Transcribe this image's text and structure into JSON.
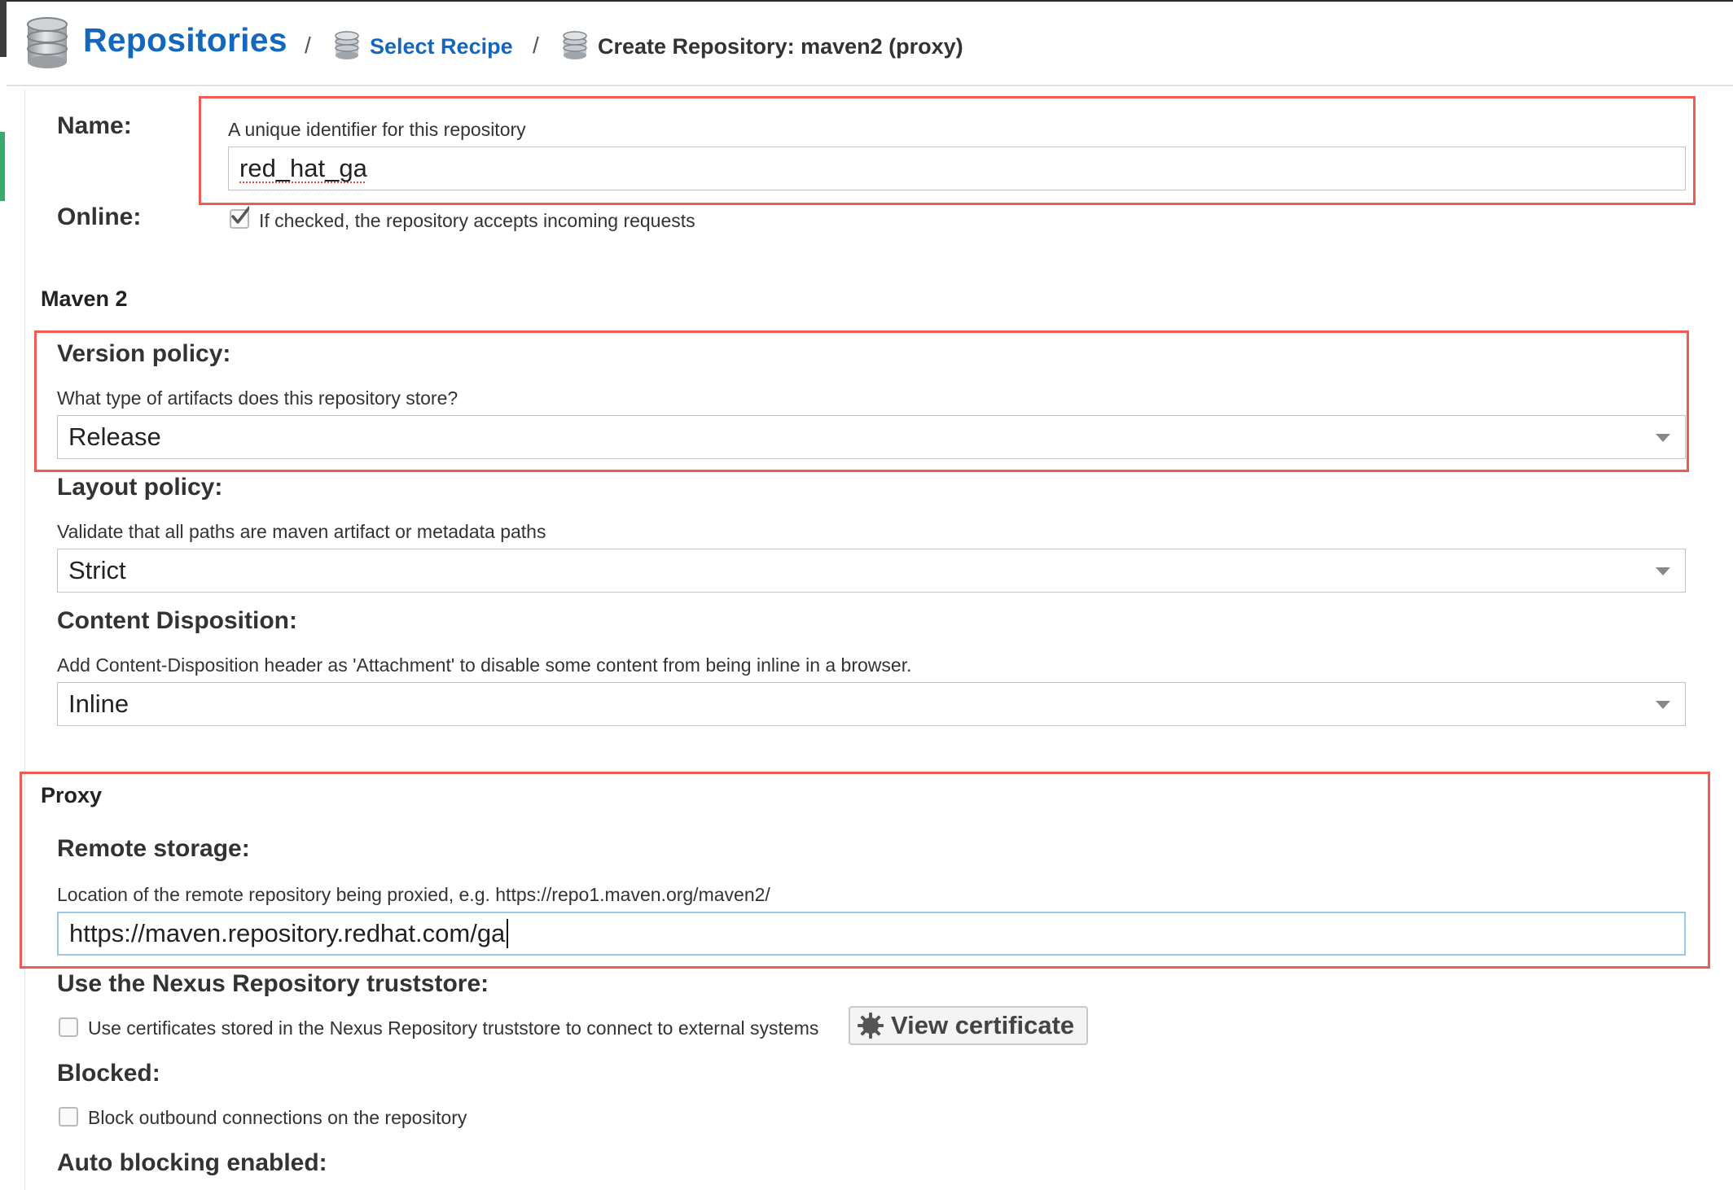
{
  "breadcrumb": {
    "root": "Repositories",
    "separator": "/",
    "step2": "Select Recipe",
    "current": "Create Repository: maven2 (proxy)"
  },
  "form": {
    "name": {
      "label": "Name:",
      "help": "A unique identifier for this repository",
      "value": "red_hat_ga"
    },
    "online": {
      "label": "Online:",
      "checked": true,
      "help": "If checked, the repository accepts incoming requests"
    },
    "maven_section": "Maven 2",
    "version_policy": {
      "label": "Version policy:",
      "help": "What type of artifacts does this repository store?",
      "value": "Release"
    },
    "layout_policy": {
      "label": "Layout policy:",
      "help": "Validate that all paths are maven artifact or metadata paths",
      "value": "Strict"
    },
    "content_disposition": {
      "label": "Content Disposition:",
      "help": "Add Content-Disposition header as 'Attachment' to disable some content from being inline in a browser.",
      "value": "Inline"
    },
    "proxy_section": "Proxy",
    "remote_storage": {
      "label": "Remote storage:",
      "help": "Location of the remote repository being proxied, e.g. https://repo1.maven.org/maven2/",
      "value": "https://maven.repository.redhat.com/ga"
    },
    "truststore": {
      "label": "Use the Nexus Repository truststore:",
      "checked": false,
      "help": "Use certificates stored in the Nexus Repository truststore to connect to external systems",
      "button": "View certificate"
    },
    "blocked": {
      "label": "Blocked:",
      "checked": false,
      "help": "Block outbound connections on the repository"
    },
    "auto_blocking": {
      "label": "Auto blocking enabled:"
    }
  },
  "colors": {
    "link": "#1567bc",
    "highlight_box": "#ef5b53",
    "focus_border": "#9cc8e6",
    "left_accent": "#3aa970"
  },
  "icons": [
    "database-icon",
    "checkmark-icon",
    "chevron-down-icon",
    "gear-icon"
  ]
}
